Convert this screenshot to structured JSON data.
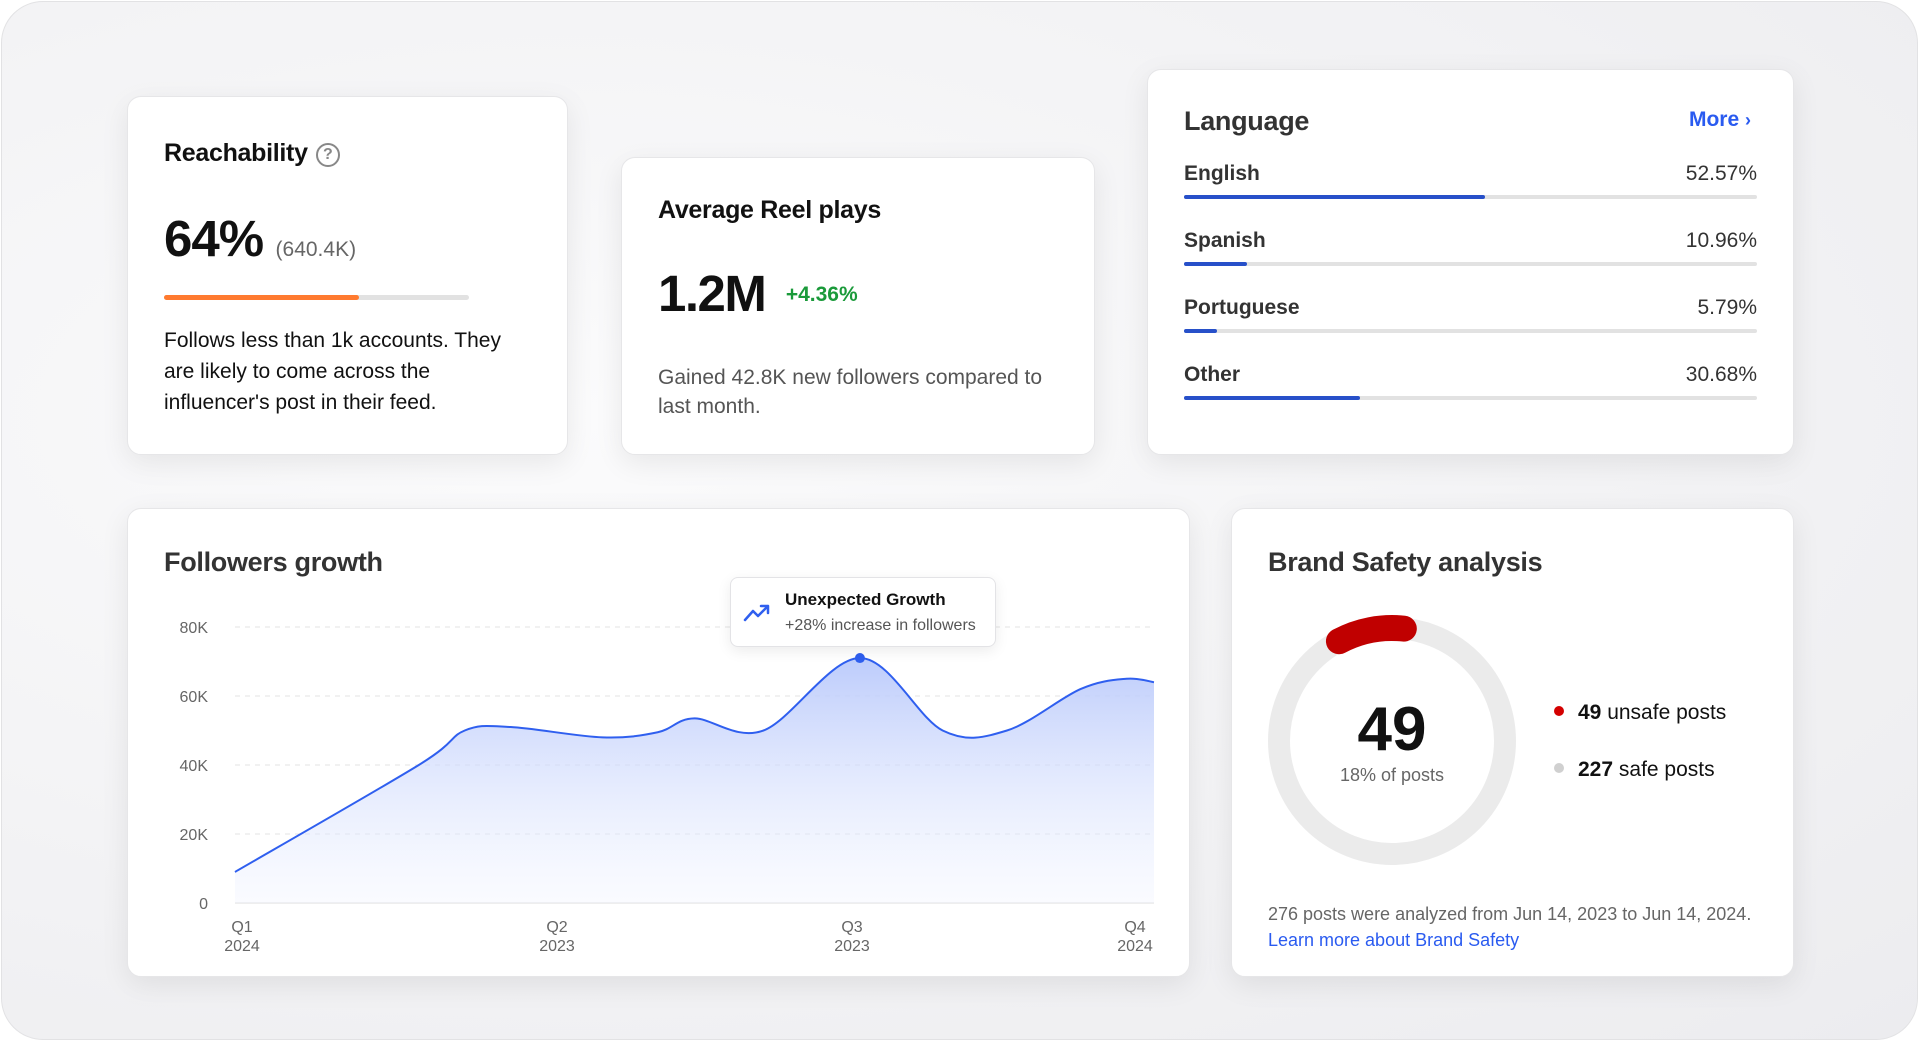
{
  "reachability": {
    "title": "Reachability",
    "help_icon": "question-circle-icon",
    "value": "64%",
    "count": "(640.4K)",
    "progress_percent": 64,
    "bar_color": "#ff7a2f",
    "description": "Follows less than 1k accounts. They are likely to come across the influencer's post in their feed."
  },
  "reel": {
    "title": "Average Reel plays",
    "value": "1.2M",
    "change": "+4.36%",
    "change_color": "#1a9a3a",
    "description": "Gained 42.8K new followers compared to last month."
  },
  "language": {
    "title": "Language",
    "more_label": "More",
    "more_icon": "chevron-right-icon",
    "bar_color": "#2750c9",
    "items": [
      {
        "name": "English",
        "percent_label": "52.57%",
        "value": 52.57
      },
      {
        "name": "Spanish",
        "percent_label": "10.96%",
        "value": 10.96
      },
      {
        "name": "Portuguese",
        "percent_label": "5.79%",
        "value": 5.79
      },
      {
        "name": "Other",
        "percent_label": "30.68%",
        "value": 30.68
      }
    ]
  },
  "followers": {
    "title": "Followers growth",
    "tooltip": {
      "icon": "trending-up-icon",
      "title": "Unexpected Growth",
      "subtitle": "+28% increase in followers"
    }
  },
  "chart_data": {
    "type": "area",
    "title": "Followers growth",
    "ylim": [
      0,
      80000
    ],
    "yticks": [
      "0",
      "20K",
      "40K",
      "60K",
      "80K"
    ],
    "ytick_values": [
      0,
      20000,
      40000,
      60000,
      80000
    ],
    "xticks": [
      {
        "q": "Q1",
        "y": "2024"
      },
      {
        "q": "Q2",
        "y": "2023"
      },
      {
        "q": "Q3",
        "y": "2023"
      },
      {
        "q": "Q4",
        "y": "2024"
      }
    ],
    "x": [
      0,
      0.2,
      0.25,
      0.3,
      0.4,
      0.46,
      0.5,
      0.575,
      0.68,
      0.77,
      0.84,
      0.92,
      0.97,
      1
    ],
    "values": [
      9000,
      40000,
      50000,
      51000,
      48000,
      49500,
      53500,
      50000,
      71000,
      50000,
      50000,
      62000,
      65000,
      64000
    ],
    "highlight_index": 8,
    "line_color": "#2f5fef"
  },
  "brand_safety": {
    "title": "Brand Safety analysis",
    "center_value": "49",
    "center_caption": "18% of posts",
    "unsafe_fraction": 0.18,
    "unsafe_color": "#c00000",
    "safe_color": "#ebebeb",
    "legend": [
      {
        "count": "49",
        "label": "unsafe posts",
        "color": "#d40000"
      },
      {
        "count": "227",
        "label": "safe posts",
        "color": "#d0d0d0"
      }
    ],
    "footer": "276 posts were analyzed from Jun 14, 2023 to Jun 14, 2024.",
    "link": "Learn more about Brand Safety"
  }
}
